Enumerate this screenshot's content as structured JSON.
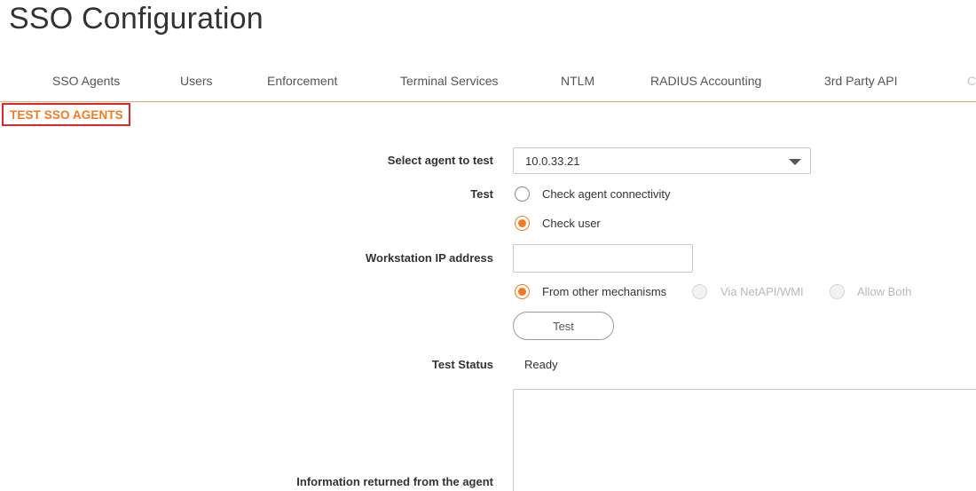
{
  "page": {
    "title": "SSO Configuration"
  },
  "tabs": [
    {
      "label": "SSO Agents",
      "faded": false
    },
    {
      "label": "Users",
      "faded": false
    },
    {
      "label": "Enforcement",
      "faded": false
    },
    {
      "label": "Terminal Services",
      "faded": false
    },
    {
      "label": "NTLM",
      "faded": false
    },
    {
      "label": "RADIUS Accounting",
      "faded": false
    },
    {
      "label": "3rd Party API",
      "faded": false
    },
    {
      "label": "C",
      "faded": true
    }
  ],
  "section": {
    "title": "TEST SSO AGENTS"
  },
  "form": {
    "agent_label": "Select agent to test",
    "agent_value": "10.0.33.21",
    "test_label": "Test",
    "test_options": [
      {
        "label": "Check agent connectivity",
        "checked": false
      },
      {
        "label": "Check user",
        "checked": true
      }
    ],
    "workstation_label": "Workstation IP address",
    "workstation_value": "",
    "mechanism_options": [
      {
        "label": "From other mechanisms",
        "checked": true,
        "disabled": false
      },
      {
        "label": "Via NetAPI/WMI",
        "checked": false,
        "disabled": true
      },
      {
        "label": "Allow Both",
        "checked": false,
        "disabled": true
      }
    ],
    "test_button_label": "Test",
    "status_label": "Test Status",
    "status_value": "Ready",
    "info_label": "Information returned from the agent",
    "info_value": ""
  },
  "colors": {
    "accent": "#f47a20",
    "highlight_border": "#e0242c",
    "tab_underline": "#f0a868"
  },
  "icons": {
    "dropdown": "chevron-down-icon"
  }
}
